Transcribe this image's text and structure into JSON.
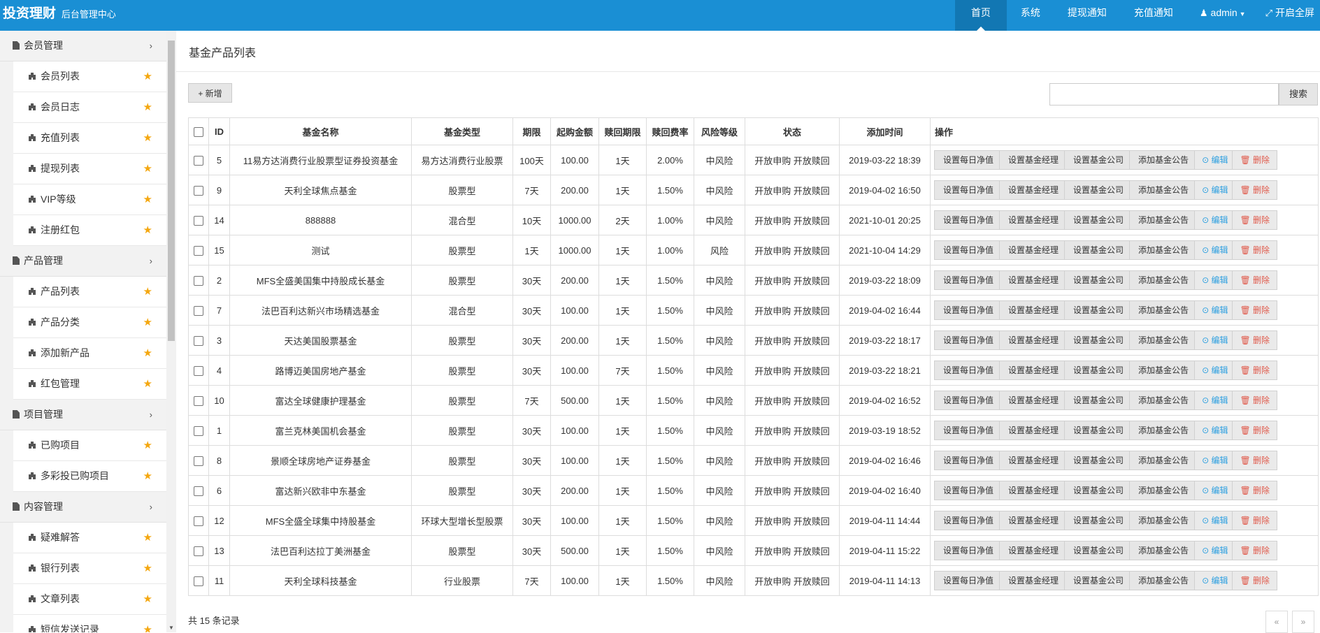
{
  "header": {
    "logo_title": "投资理财",
    "logo_subtitle": "后台管理中心",
    "nav": [
      {
        "label": "首页",
        "icon": "",
        "active": true
      },
      {
        "label": "系统",
        "icon": ""
      },
      {
        "label": "提现通知",
        "icon": ""
      },
      {
        "label": "充值通知",
        "icon": ""
      },
      {
        "label": "admin",
        "icon": "user-icon",
        "suffix": "caret-down-icon"
      },
      {
        "label": "开启全屏",
        "icon": "fullscreen-icon"
      }
    ]
  },
  "sidebar": {
    "groups": [
      {
        "label": "会员管理",
        "items": [
          "会员列表",
          "会员日志",
          "充值列表",
          "提现列表",
          "VIP等级",
          "注册红包"
        ]
      },
      {
        "label": "产品管理",
        "items": [
          "产品列表",
          "产品分类",
          "添加新产品",
          "红包管理"
        ]
      },
      {
        "label": "项目管理",
        "items": [
          "已购项目",
          "多彩投已购项目"
        ]
      },
      {
        "label": "内容管理",
        "items": [
          "疑难解答",
          "银行列表",
          "文章列表",
          "短信发送记录"
        ]
      }
    ]
  },
  "main": {
    "page_title": "基金产品列表",
    "add_label": "+ 新增",
    "search_label": "搜索",
    "search_value": "",
    "columns": [
      "ID",
      "基金名称",
      "基金类型",
      "期限",
      "起购金额",
      "赎回期限",
      "赎回费率",
      "风险等级",
      "状态",
      "添加时间",
      "操作"
    ],
    "action_labels": [
      "设置每日净值",
      "设置基金经理",
      "设置基金公司",
      "添加基金公告"
    ],
    "edit_label": "⊙ 编辑",
    "delete_label": "🗑 删除",
    "rows": [
      {
        "id": "5",
        "name": "11易方达消费行业股票型证券投资基金",
        "type": "易方达消费行业股票",
        "term": "100天",
        "min": "100.00",
        "redeem": "1天",
        "fee": "2.00%",
        "risk": "中风险",
        "status": "开放申购 开放赎回",
        "time": "2019-03-22 18:39"
      },
      {
        "id": "9",
        "name": "天利全球焦点基金",
        "type": "股票型",
        "term": "7天",
        "min": "200.00",
        "redeem": "1天",
        "fee": "1.50%",
        "risk": "中风险",
        "status": "开放申购 开放赎回",
        "time": "2019-04-02 16:50"
      },
      {
        "id": "14",
        "name": "888888",
        "type": "混合型",
        "term": "10天",
        "min": "1000.00",
        "redeem": "2天",
        "fee": "1.00%",
        "risk": "中风险",
        "status": "开放申购 开放赎回",
        "time": "2021-10-01 20:25"
      },
      {
        "id": "15",
        "name": "测试",
        "type": "股票型",
        "term": "1天",
        "min": "1000.00",
        "redeem": "1天",
        "fee": "1.00%",
        "risk": "风险",
        "status": "开放申购 开放赎回",
        "time": "2021-10-04 14:29"
      },
      {
        "id": "2",
        "name": "MFS全盛美国集中持股成长基金",
        "type": "股票型",
        "term": "30天",
        "min": "200.00",
        "redeem": "1天",
        "fee": "1.50%",
        "risk": "中风险",
        "status": "开放申购 开放赎回",
        "time": "2019-03-22 18:09"
      },
      {
        "id": "7",
        "name": "法巴百利达新兴市场精选基金",
        "type": "混合型",
        "term": "30天",
        "min": "100.00",
        "redeem": "1天",
        "fee": "1.50%",
        "risk": "中风险",
        "status": "开放申购 开放赎回",
        "time": "2019-04-02 16:44"
      },
      {
        "id": "3",
        "name": "天达美国股票基金",
        "type": "股票型",
        "term": "30天",
        "min": "200.00",
        "redeem": "1天",
        "fee": "1.50%",
        "risk": "中风险",
        "status": "开放申购 开放赎回",
        "time": "2019-03-22 18:17"
      },
      {
        "id": "4",
        "name": "路博迈美国房地产基金",
        "type": "股票型",
        "term": "30天",
        "min": "100.00",
        "redeem": "7天",
        "fee": "1.50%",
        "risk": "中风险",
        "status": "开放申购 开放赎回",
        "time": "2019-03-22 18:21"
      },
      {
        "id": "10",
        "name": "富达全球健康护理基金",
        "type": "股票型",
        "term": "7天",
        "min": "500.00",
        "redeem": "1天",
        "fee": "1.50%",
        "risk": "中风险",
        "status": "开放申购 开放赎回",
        "time": "2019-04-02 16:52"
      },
      {
        "id": "1",
        "name": "富兰克林美国机会基金",
        "type": "股票型",
        "term": "30天",
        "min": "100.00",
        "redeem": "1天",
        "fee": "1.50%",
        "risk": "中风险",
        "status": "开放申购 开放赎回",
        "time": "2019-03-19 18:52"
      },
      {
        "id": "8",
        "name": "景顺全球房地产证券基金",
        "type": "股票型",
        "term": "30天",
        "min": "100.00",
        "redeem": "1天",
        "fee": "1.50%",
        "risk": "中风险",
        "status": "开放申购 开放赎回",
        "time": "2019-04-02 16:46"
      },
      {
        "id": "6",
        "name": "富达新兴欧非中东基金",
        "type": "股票型",
        "term": "30天",
        "min": "200.00",
        "redeem": "1天",
        "fee": "1.50%",
        "risk": "中风险",
        "status": "开放申购 开放赎回",
        "time": "2019-04-02 16:40"
      },
      {
        "id": "12",
        "name": "MFS全盛全球集中持股基金",
        "type": "环球大型增长型股票",
        "term": "30天",
        "min": "100.00",
        "redeem": "1天",
        "fee": "1.50%",
        "risk": "中风险",
        "status": "开放申购 开放赎回",
        "time": "2019-04-11 14:44"
      },
      {
        "id": "13",
        "name": "法巴百利达拉丁美洲基金",
        "type": "股票型",
        "term": "30天",
        "min": "500.00",
        "redeem": "1天",
        "fee": "1.50%",
        "risk": "中风险",
        "status": "开放申购 开放赎回",
        "time": "2019-04-11 15:22"
      },
      {
        "id": "11",
        "name": "天利全球科技基金",
        "type": "行业股票",
        "term": "7天",
        "min": "100.00",
        "redeem": "1天",
        "fee": "1.50%",
        "risk": "中风险",
        "status": "开放申购 开放赎回",
        "time": "2019-04-11 14:13"
      }
    ],
    "total_text": "共 15 条记录",
    "pager_prev": "«",
    "pager_next": "»"
  },
  "colors": {
    "header_bg": "#1a8fd4",
    "header_active": "#1277b3",
    "star": "#f4a70f",
    "edit": "#2b9fe0",
    "delete": "#e05a4b"
  }
}
